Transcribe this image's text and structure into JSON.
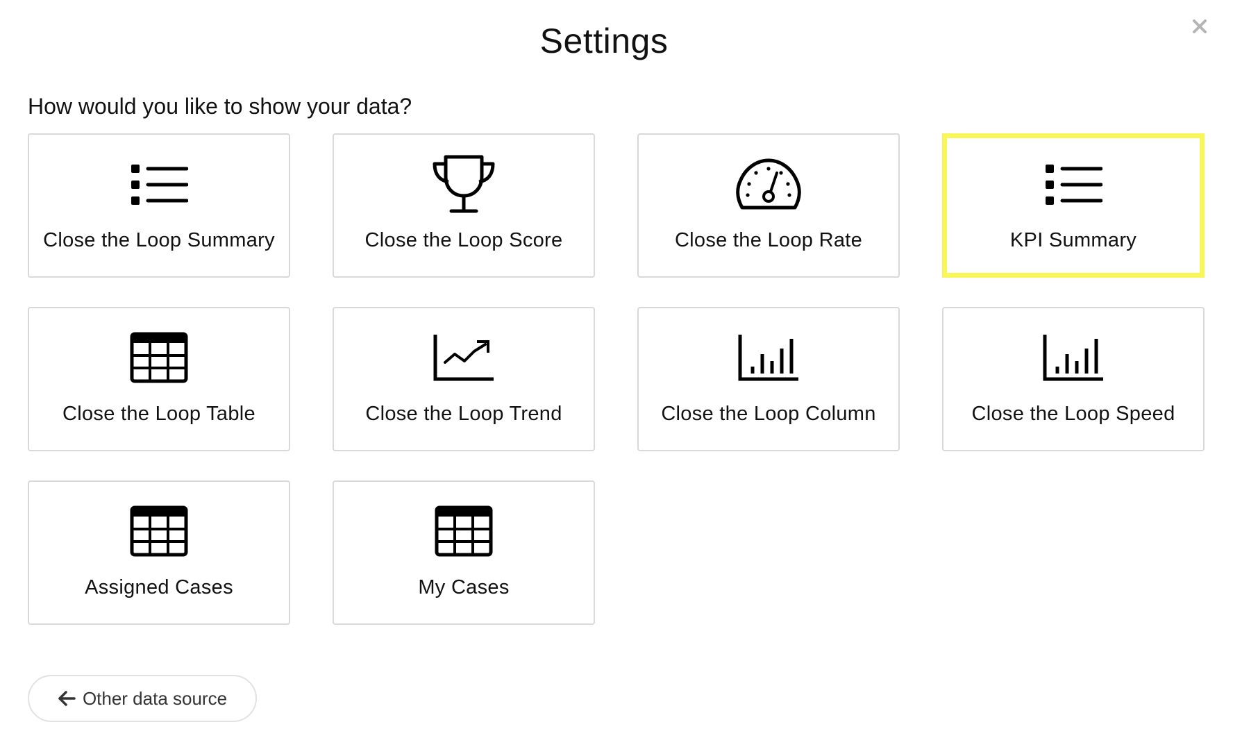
{
  "dialog": {
    "title": "Settings",
    "close_icon": "close-icon",
    "question": "How would you like to show your data?"
  },
  "tiles": [
    {
      "label": "Close the Loop Summary",
      "icon": "list-icon",
      "selected": false
    },
    {
      "label": "Close the Loop Score",
      "icon": "trophy-icon",
      "selected": false
    },
    {
      "label": "Close the Loop Rate",
      "icon": "gauge-icon",
      "selected": false
    },
    {
      "label": "KPI Summary",
      "icon": "list-icon",
      "selected": true
    },
    {
      "label": "Close the Loop Table",
      "icon": "table-icon",
      "selected": false
    },
    {
      "label": "Close the Loop Trend",
      "icon": "trend-chart-icon",
      "selected": false
    },
    {
      "label": "Close the Loop Column",
      "icon": "bar-chart-icon",
      "selected": false
    },
    {
      "label": "Close the Loop Speed",
      "icon": "bar-chart-icon",
      "selected": false
    },
    {
      "label": "Assigned Cases",
      "icon": "table-icon",
      "selected": false
    },
    {
      "label": "My Cases",
      "icon": "table-icon",
      "selected": false
    }
  ],
  "footer": {
    "back_label": "Other data source",
    "back_icon": "arrow-left-icon"
  },
  "colors": {
    "selected_border": "#f9f65a",
    "tile_border": "#d9d9d9",
    "text": "#111111"
  }
}
